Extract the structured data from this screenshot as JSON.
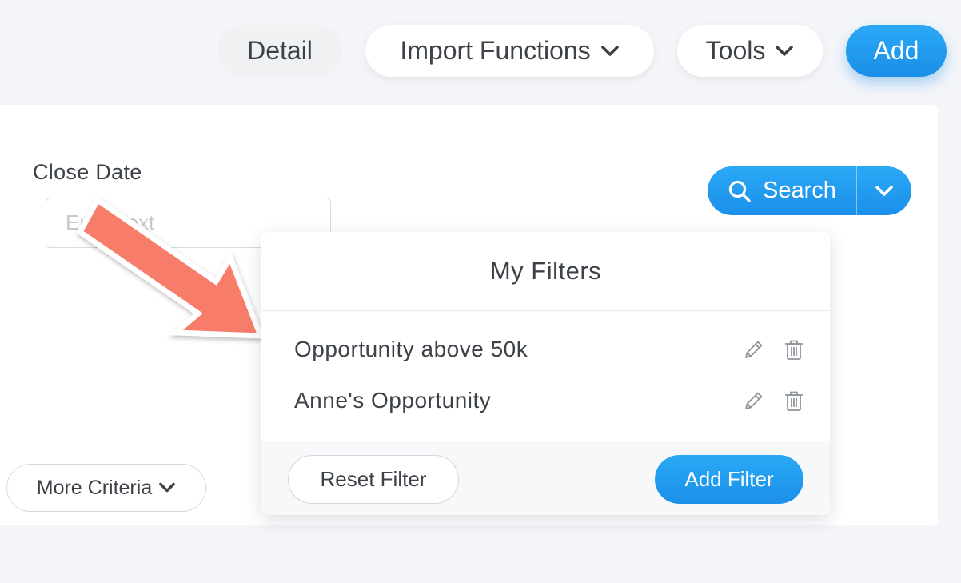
{
  "toolbar": {
    "detail_label": "Detail",
    "import_label": "Import Functions",
    "tools_label": "Tools",
    "add_label": "Add"
  },
  "form": {
    "close_date_label": "Close Date",
    "close_date_placeholder": "Enter text",
    "close_date_value": ""
  },
  "search": {
    "label": "Search"
  },
  "more_criteria_label": "More Criteria",
  "filters_popover": {
    "title": "My Filters",
    "items": [
      {
        "label": "Opportunity above 50k"
      },
      {
        "label": "Anne's Opportunity"
      }
    ],
    "reset_label": "Reset Filter",
    "add_filter_label": "Add Filter"
  },
  "colors": {
    "primary": "#1b8fe9",
    "annotation_arrow": "#f77d6a",
    "background": "#f3f5f9"
  },
  "icons": [
    "chevron-down-icon",
    "search-icon",
    "pencil-icon",
    "trash-icon",
    "arrow-annotation"
  ]
}
